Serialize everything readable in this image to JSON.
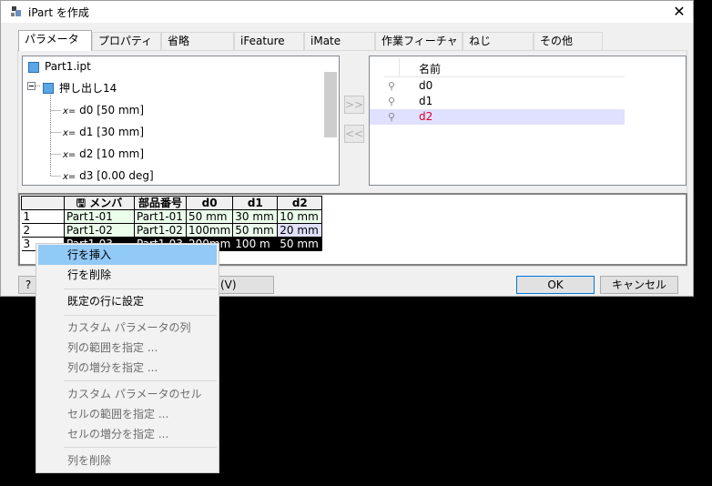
{
  "window": {
    "title": "iPart を作成",
    "close_glyph": "✕"
  },
  "tabs": [
    {
      "label": "パラメータ",
      "active": true
    },
    {
      "label": "プロパティ"
    },
    {
      "label": "省略"
    },
    {
      "label": "iFeature"
    },
    {
      "label": "iMate"
    },
    {
      "label": "作業フィーチャ"
    },
    {
      "label": "ねじ"
    },
    {
      "label": "その他"
    }
  ],
  "tree": {
    "root": "Part1.ipt",
    "feature": "押し出し14",
    "params": [
      "d0 [50 mm]",
      "d1 [30 mm]",
      "d2 [10 mm]",
      "d3 [0.00 deg]"
    ],
    "param_prefix": "x="
  },
  "move_buttons": {
    "add": ">>",
    "remove": "<<"
  },
  "param_list": {
    "header": "名前",
    "items": [
      {
        "name": "d0",
        "color": "#000000"
      },
      {
        "name": "d1",
        "color": "#000000"
      },
      {
        "name": "d2",
        "color": "#e0002a",
        "selected": true
      }
    ]
  },
  "grid": {
    "columns": [
      "",
      "メンバ",
      "部品番号",
      "d0",
      "d1",
      "d2"
    ],
    "rows": [
      {
        "index": "1",
        "cells": [
          "Part1-01",
          "Part1-01",
          "50 mm",
          "30 mm",
          "10 mm"
        ]
      },
      {
        "index": "2",
        "cells": [
          "Part1-02",
          "Part1-02",
          "100mm",
          "50 mm",
          "20 mm"
        ]
      },
      {
        "index": "3",
        "cells": [
          "Part1-03",
          "Part1-03",
          "200mm",
          "100 m",
          "50 mm"
        ]
      }
    ]
  },
  "buttons": {
    "help": "?",
    "middle_suffix": "(V)",
    "ok": "OK",
    "cancel": "キャンセル"
  },
  "context_menu": {
    "items": [
      {
        "label": "行を挿入",
        "enabled": true,
        "highlighted": true
      },
      {
        "label": "行を削除",
        "enabled": true
      },
      {
        "sep": true
      },
      {
        "label": "既定の行に設定",
        "enabled": true
      },
      {
        "sep": true
      },
      {
        "label": "カスタム パラメータの列",
        "enabled": false
      },
      {
        "label": "列の範囲を指定 ...",
        "enabled": false
      },
      {
        "label": "列の増分を指定 ...",
        "enabled": false
      },
      {
        "sep": true
      },
      {
        "label": "カスタム パラメータのセル",
        "enabled": false
      },
      {
        "label": "セルの範囲を指定 ...",
        "enabled": false
      },
      {
        "label": "セルの増分を指定 ...",
        "enabled": false
      },
      {
        "sep": true
      },
      {
        "label": "列を削除",
        "enabled": false
      }
    ]
  }
}
